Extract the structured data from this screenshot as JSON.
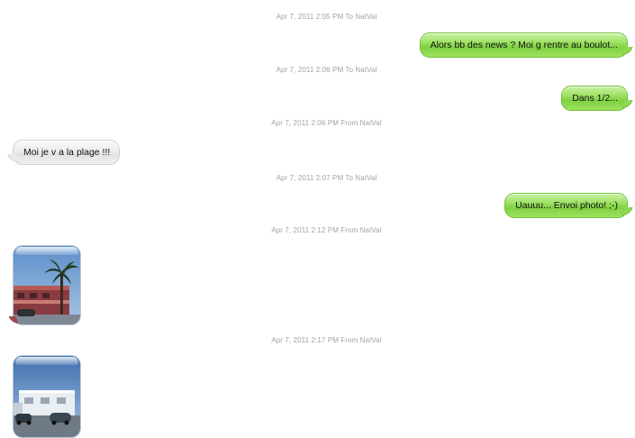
{
  "conversation": {
    "entries": [
      {
        "timestamp": "Apr 7, 2011 2:05 PM To NatVal",
        "message": "Alors bb des news ? Moi g rentre au boulot..."
      },
      {
        "timestamp": "Apr 7, 2011 2:06 PM To NatVal",
        "message": "Dans 1/2..."
      },
      {
        "timestamp": "Apr 7, 2011 2:06 PM From NatVal",
        "message": "Moi je v a la  plage !!!"
      },
      {
        "timestamp": "Apr 7, 2011 2:07 PM To NatVal",
        "message": "Uauuu... Envoi photo! ;-)"
      },
      {
        "timestamp": "Apr 7, 2011 2:12 PM From NatVal",
        "photo": "photo-palm-tree-building"
      },
      {
        "timestamp": "Apr 7, 2011 2:17 PM From NatVal",
        "photo": "photo-white-building-cars"
      }
    ]
  },
  "colors": {
    "sent_bubble": "#9fe264",
    "received_bubble": "#ededed",
    "timestamp_text": "#a3a3a3"
  }
}
